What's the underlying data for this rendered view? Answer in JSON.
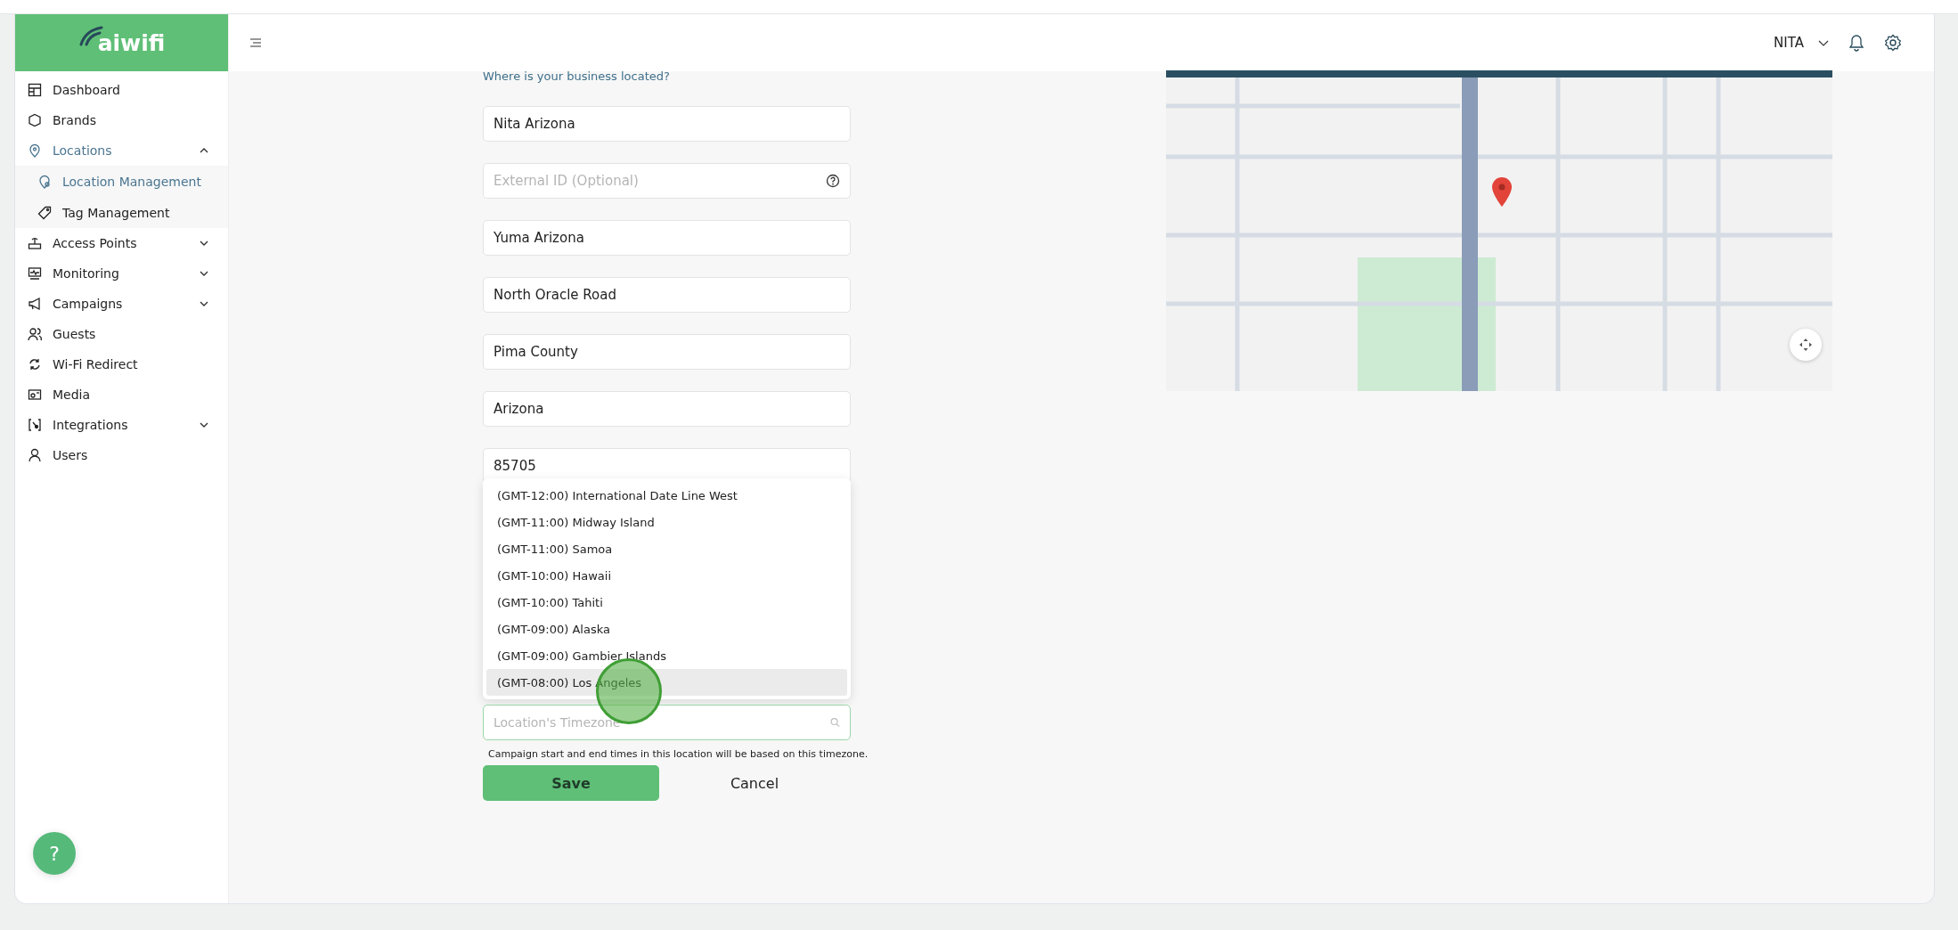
{
  "brand": {
    "logo_text": "aiwifi"
  },
  "header": {
    "user": "NITA"
  },
  "sidebar": {
    "items": [
      {
        "label": "Dashboard",
        "expandable": false,
        "selected": false
      },
      {
        "label": "Brands",
        "expandable": false,
        "selected": false
      },
      {
        "label": "Locations",
        "expandable": true,
        "expanded": true,
        "selected": true,
        "children": [
          {
            "label": "Location Management",
            "selected": true
          },
          {
            "label": "Tag Management",
            "selected": false
          }
        ]
      },
      {
        "label": "Access Points",
        "expandable": true,
        "expanded": false,
        "selected": false
      },
      {
        "label": "Monitoring",
        "expandable": true,
        "expanded": false,
        "selected": false
      },
      {
        "label": "Campaigns",
        "expandable": true,
        "expanded": false,
        "selected": false
      },
      {
        "label": "Guests",
        "expandable": false,
        "selected": false
      },
      {
        "label": "Wi-Fi Redirect",
        "expandable": false,
        "selected": false
      },
      {
        "label": "Media",
        "expandable": false,
        "selected": false
      },
      {
        "label": "Integrations",
        "expandable": true,
        "expanded": false,
        "selected": false
      },
      {
        "label": "Users",
        "expandable": false,
        "selected": false
      }
    ]
  },
  "form": {
    "question": "Where is your business located?",
    "fields": [
      {
        "kind": "text",
        "value": "Nita Arizona"
      },
      {
        "kind": "help",
        "placeholder": "External ID (Optional)"
      },
      {
        "kind": "text",
        "value": "Yuma Arizona"
      },
      {
        "kind": "text",
        "value": "North Oracle Road"
      },
      {
        "kind": "text",
        "value": "Pima County"
      },
      {
        "kind": "text",
        "value": "Arizona"
      },
      {
        "kind": "text",
        "value": "85705"
      }
    ],
    "timezone": {
      "placeholder": "Location's Timezone",
      "focused": true,
      "options": [
        {
          "label": "(GMT-12:00) International Date Line West",
          "selected": false
        },
        {
          "label": "(GMT-11:00) Midway Island",
          "selected": false
        },
        {
          "label": "(GMT-11:00) Samoa",
          "selected": false
        },
        {
          "label": "(GMT-10:00) Hawaii",
          "selected": false
        },
        {
          "label": "(GMT-10:00) Tahiti",
          "selected": false
        },
        {
          "label": "(GMT-09:00) Alaska",
          "selected": false
        },
        {
          "label": "(GMT-09:00) Gambier Islands",
          "selected": false
        },
        {
          "label": "(GMT-08:00) Los Angeles",
          "selected": true
        }
      ]
    },
    "note": "Campaign start and end times in this location will be based on this timezone.",
    "save": "Save",
    "cancel": "Cancel"
  },
  "help_button": {
    "label": "?"
  }
}
